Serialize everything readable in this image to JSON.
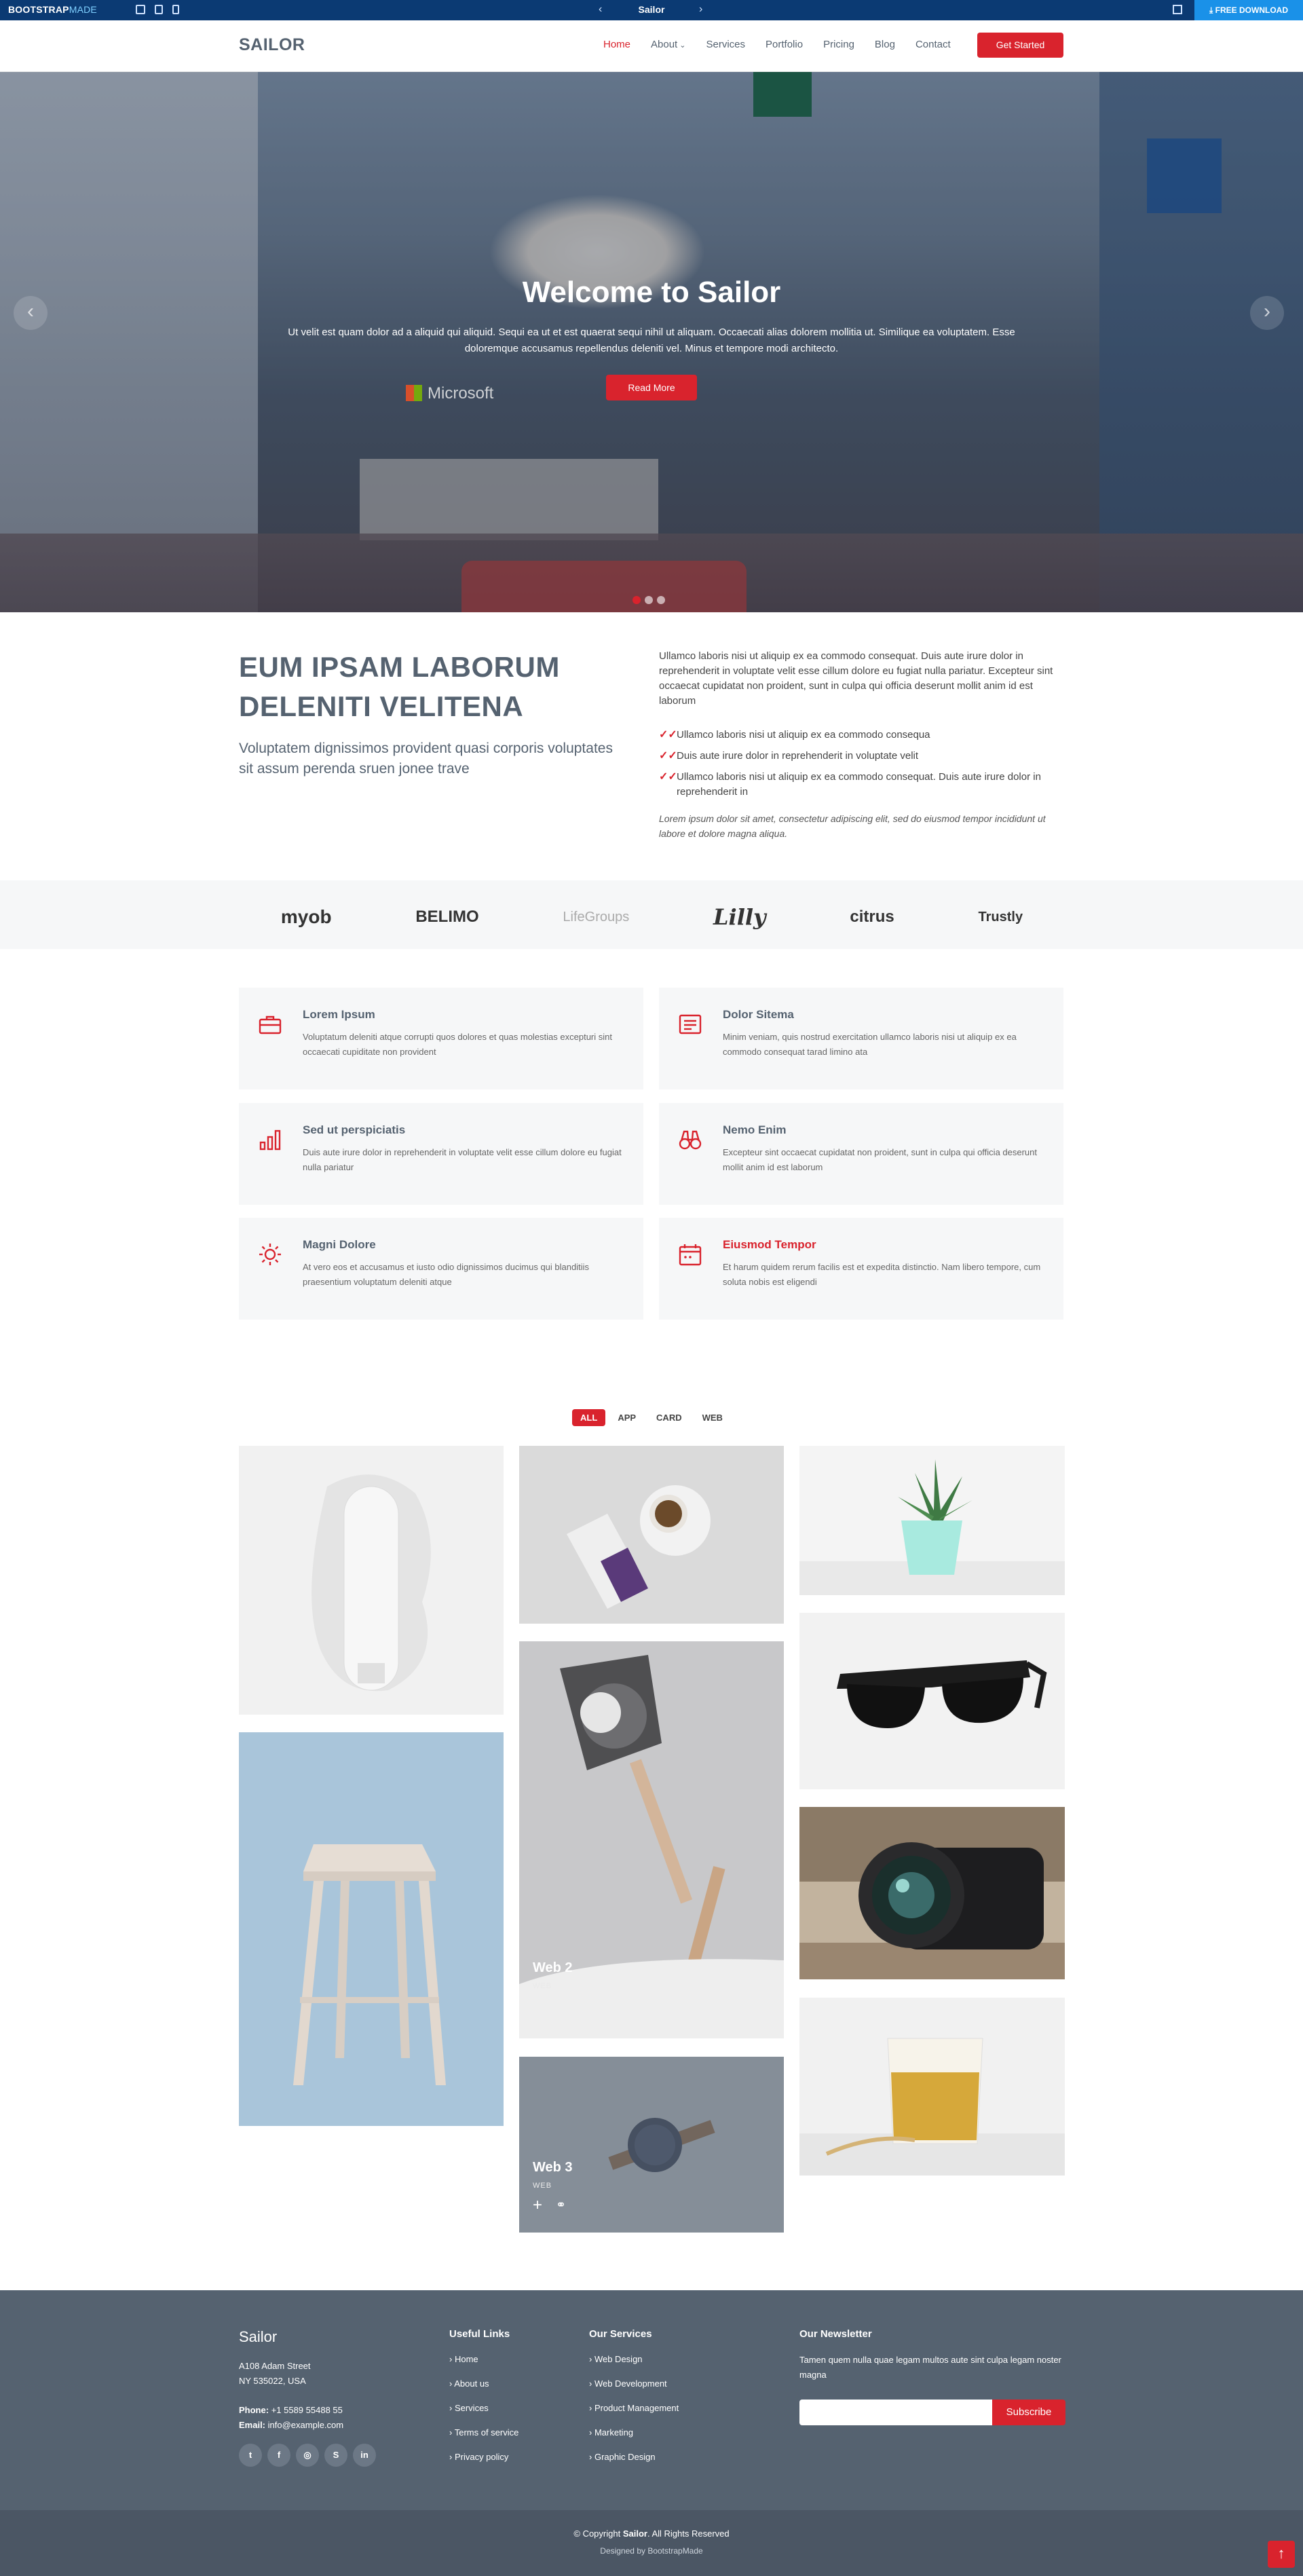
{
  "topbar": {
    "brand_a": "BOOTSTRAP",
    "brand_b": "MADE",
    "center_title": "Sailor",
    "download_label": "FREE DOWNLOAD",
    "icons": [
      "desktop-icon",
      "tablet-icon",
      "mobile-icon",
      "external-link-icon",
      "download-icon"
    ]
  },
  "header": {
    "logo": "SAILOR",
    "nav": [
      "Home",
      "About",
      "Services",
      "Portfolio",
      "Pricing",
      "Blog",
      "Contact"
    ],
    "active": "Home",
    "cta": "Get Started"
  },
  "hero": {
    "title": "Welcome to Sailor",
    "text": "Ut velit est quam dolor ad a aliquid qui aliquid. Sequi ea ut et est quaerat sequi nihil ut aliquam. Occaecati alias dolorem mollitia ut. Similique ea voluptatem. Esse doloremque accusamus repellendus deleniti vel. Minus et tempore modi architecto.",
    "button": "Read More",
    "background_sign": "Microsoft",
    "slides": 3,
    "active_slide": 1
  },
  "about": {
    "heading": "EUM IPSAM LABORUM DELENITI VELITENA",
    "subheading": "Voluptatem dignissimos provident quasi corporis voluptates sit assum perenda sruen jonee trave",
    "intro": "Ullamco laboris nisi ut aliquip ex ea commodo consequat. Duis aute irure dolor in reprehenderit in voluptate velit esse cillum dolore eu fugiat nulla pariatur. Excepteur sint occaecat cupidatat non proident, sunt in culpa qui officia deserunt mollit anim id est laborum",
    "checks": [
      "Ullamco laboris nisi ut aliquip ex ea commodo consequa",
      "Duis aute irure dolor in reprehenderit in voluptate velit",
      "Ullamco laboris nisi ut aliquip ex ea commodo consequat. Duis aute irure dolor in reprehenderit in"
    ],
    "italic": "Lorem ipsum dolor sit amet, consectetur adipiscing elit, sed do eiusmod tempor incididunt ut labore et dolore magna aliqua."
  },
  "clients": [
    "myob",
    "BELIMO",
    "LifeGroups",
    "Lilly",
    "citrus",
    "Trustly"
  ],
  "services": [
    {
      "title": "Lorem Ipsum",
      "text": "Voluptatum deleniti atque corrupti quos dolores et quas molestias excepturi sint occaecati cupiditate non provident",
      "icon": "briefcase-icon"
    },
    {
      "title": "Dolor Sitema",
      "text": "Minim veniam, quis nostrud exercitation ullamco laboris nisi ut aliquip ex ea commodo consequat tarad limino ata",
      "icon": "checklist-icon"
    },
    {
      "title": "Sed ut perspiciatis",
      "text": "Duis aute irure dolor in reprehenderit in voluptate velit esse cillum dolore eu fugiat nulla pariatur",
      "icon": "bar-chart-icon"
    },
    {
      "title": "Nemo Enim",
      "text": "Excepteur sint occaecat cupidatat non proident, sunt in culpa qui officia deserunt mollit anim id est laborum",
      "icon": "binoculars-icon"
    },
    {
      "title": "Magni Dolore",
      "text": "At vero eos et accusamus et iusto odio dignissimos ducimus qui blanditiis praesentium voluptatum deleniti atque",
      "icon": "sun-icon"
    },
    {
      "title": "Eiusmod Tempor",
      "text": "Et harum quidem rerum facilis est et expedita distinctio. Nam libero tempore, cum soluta nobis est eligendi",
      "icon": "calendar-icon"
    }
  ],
  "portfolio": {
    "filters": [
      "ALL",
      "APP",
      "CARD",
      "WEB"
    ],
    "active_filter": "ALL",
    "items": [
      {
        "label": "Web 2",
        "category": "WEB"
      },
      {
        "label": "Web 3",
        "category": "WEB"
      }
    ]
  },
  "footer": {
    "brand": "Sailor",
    "address_1": "A108 Adam Street",
    "address_2": "NY 535022, USA",
    "phone_label": "Phone:",
    "phone": "+1 5589 55488 55",
    "email_label": "Email:",
    "email": "info@example.com",
    "useful_title": "Useful Links",
    "useful_links": [
      "Home",
      "About us",
      "Services",
      "Terms of service",
      "Privacy policy"
    ],
    "services_title": "Our Services",
    "service_links": [
      "Web Design",
      "Web Development",
      "Product Management",
      "Marketing",
      "Graphic Design"
    ],
    "newsletter_title": "Our Newsletter",
    "newsletter_text": "Tamen quem nulla quae legam multos aute sint culpa legam noster magna",
    "subscribe": "Subscribe",
    "social": [
      "twitter-icon",
      "facebook-icon",
      "instagram-icon",
      "skype-icon",
      "linkedin-icon"
    ],
    "copyright_pre": "© Copyright ",
    "copyright_brand": "Sailor",
    "copyright_post": ". All Rights Reserved",
    "credits": "Designed by BootstrapMade"
  },
  "colors": {
    "accent": "#d9232d",
    "heading": "#556270",
    "topbar": "#0b3a73",
    "footer": "#556270"
  }
}
